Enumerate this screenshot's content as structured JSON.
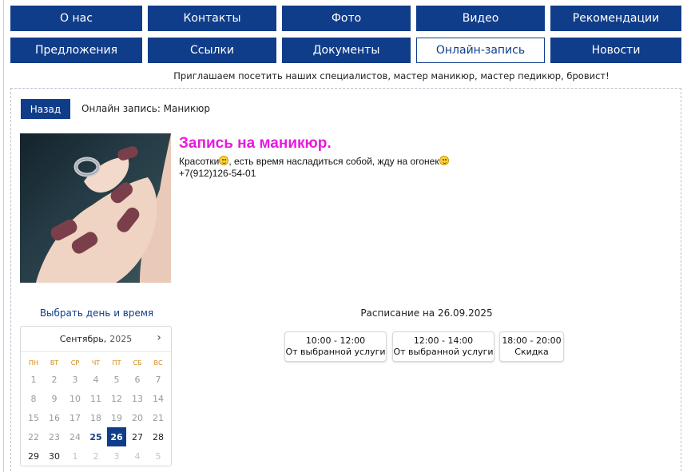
{
  "nav": {
    "row1": [
      "О нас",
      "Контакты",
      "Фото",
      "Видео",
      "Рекомендации"
    ],
    "row2": [
      "Предложения",
      "Ссылки",
      "Документы",
      "Онлайн-запись",
      "Новости"
    ],
    "active": "Онлайн-запись"
  },
  "promo": "Приглашаем посетить наших специалистов, мастер маникюр, мастер педикюр, бровист!",
  "header": {
    "back_label": "Назад",
    "breadcrumb": "Онлайн запись: Маникюр"
  },
  "service": {
    "photo_icon": "manicure-photo",
    "title": "Запись на маникюр.",
    "desc_before": "Красотки",
    "desc_after": ", есть время насладиться собой, жду на огонек",
    "phone": "+7(912)126-54-01",
    "title_color": "#e81ae0"
  },
  "booking": {
    "pick_label": "Выбрать день и время",
    "calendar": {
      "month": "Сентябрь,",
      "year": "2025",
      "weekdays": [
        "ПН",
        "ВТ",
        "СР",
        "ЧТ",
        "ПТ",
        "СБ",
        "ВС"
      ],
      "weeks": [
        [
          "1",
          "2",
          "3",
          "4",
          "5",
          "6",
          "7"
        ],
        [
          "8",
          "9",
          "10",
          "11",
          "12",
          "13",
          "14"
        ],
        [
          "15",
          "16",
          "17",
          "18",
          "19",
          "20",
          "21"
        ],
        [
          "22",
          "23",
          "24",
          "25",
          "26",
          "27",
          "28"
        ],
        [
          "29",
          "30",
          "1",
          "2",
          "3",
          "4",
          "5"
        ]
      ],
      "available_day": "25",
      "selected_day": "26"
    },
    "schedule_title": "Расписание на 26.09.2025",
    "slots": [
      {
        "time": "10:00 - 12:00",
        "note": "От выбранной услуги"
      },
      {
        "time": "12:00 - 14:00",
        "note": "От выбранной услуги"
      },
      {
        "time": "18:00 - 20:00",
        "note": "Скидка"
      }
    ]
  },
  "colors": {
    "brand": "#103d8a",
    "accent_day": "#1c3f7d",
    "weekday": "#d28a1a"
  }
}
